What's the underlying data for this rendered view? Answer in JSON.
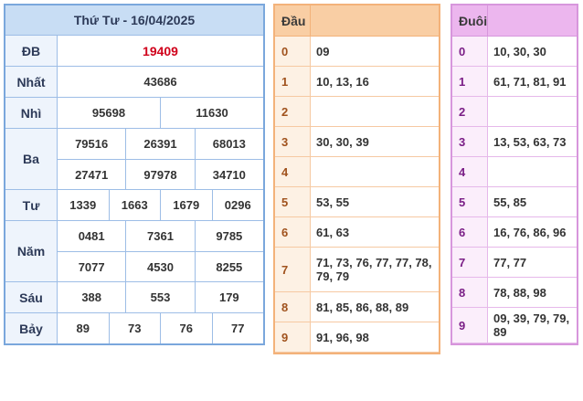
{
  "results": {
    "title": "Thứ Tư - 16/04/2025",
    "rows": [
      {
        "label": "ĐB",
        "lines": [
          [
            "19409"
          ]
        ]
      },
      {
        "label": "Nhất",
        "lines": [
          [
            "43686"
          ]
        ]
      },
      {
        "label": "Nhì",
        "lines": [
          [
            "95698",
            "11630"
          ]
        ]
      },
      {
        "label": "Ba",
        "lines": [
          [
            "79516",
            "26391",
            "68013"
          ],
          [
            "27471",
            "97978",
            "34710"
          ]
        ]
      },
      {
        "label": "Tư",
        "lines": [
          [
            "1339",
            "1663",
            "1679",
            "0296"
          ]
        ]
      },
      {
        "label": "Năm",
        "lines": [
          [
            "0481",
            "7361",
            "9785"
          ],
          [
            "7077",
            "4530",
            "8255"
          ]
        ]
      },
      {
        "label": "Sáu",
        "lines": [
          [
            "388",
            "553",
            "179"
          ]
        ]
      },
      {
        "label": "Bảy",
        "lines": [
          [
            "89",
            "73",
            "76",
            "77"
          ]
        ]
      }
    ],
    "special_color": "#d0021b"
  },
  "dau": {
    "header": "Đầu",
    "rows": [
      {
        "key": "0",
        "value": "09"
      },
      {
        "key": "1",
        "value": "10, 13, 16"
      },
      {
        "key": "2",
        "value": ""
      },
      {
        "key": "3",
        "value": "30, 30, 39"
      },
      {
        "key": "4",
        "value": ""
      },
      {
        "key": "5",
        "value": "53, 55"
      },
      {
        "key": "6",
        "value": "61, 63"
      },
      {
        "key": "7",
        "value": "71, 73, 76, 77, 77, 78, 79, 79"
      },
      {
        "key": "8",
        "value": "81, 85, 86, 88, 89"
      },
      {
        "key": "9",
        "value": "91, 96, 98"
      }
    ]
  },
  "duoi": {
    "header": "Đuôi",
    "rows": [
      {
        "key": "0",
        "value": "10, 30, 30"
      },
      {
        "key": "1",
        "value": "61, 71, 81, 91"
      },
      {
        "key": "2",
        "value": ""
      },
      {
        "key": "3",
        "value": "13, 53, 63, 73"
      },
      {
        "key": "4",
        "value": ""
      },
      {
        "key": "5",
        "value": "55, 85"
      },
      {
        "key": "6",
        "value": "16, 76, 86, 96"
      },
      {
        "key": "7",
        "value": "77, 77"
      },
      {
        "key": "8",
        "value": "78, 88, 98"
      },
      {
        "key": "9",
        "value": "09, 39, 79, 79, 89"
      }
    ]
  }
}
